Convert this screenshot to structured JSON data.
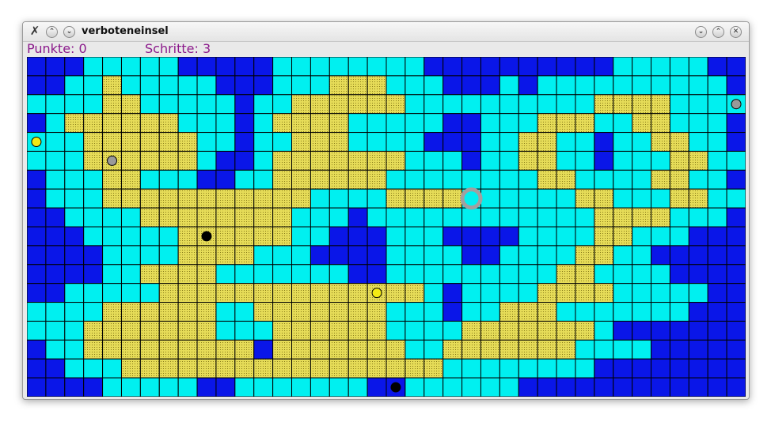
{
  "window": {
    "title": "verboteneinsel"
  },
  "status": {
    "punkte_label": "Punkte:",
    "punkte_value": "0",
    "schritte_label": "Schritte:",
    "schritte_value": "3"
  },
  "colors": {
    "deep_water": "#0a16e8",
    "shallow_water": "#00f0f0",
    "land": "#e6dc58",
    "grid": "#000000",
    "text_accent": "#8b1a8b"
  },
  "board": {
    "rows": 18,
    "cols": 38,
    "legend": {
      "D": "deep-water",
      "W": "shallow-water",
      "L": "land"
    },
    "map": [
      "DDDWWWWWDDDDDWWWWWWWWDDDDDDDDDDWWWWWDD",
      "DDWWLWWWWWDDDWWWLLLWWWDDDWDWWWWWWWWWWD",
      "WWWWLLWWWWWDWWLLLLLLWWWWWWWWWWLLLLWWWW",
      "DWLLLLLLWWWDWLLLLWWWWWDDWWWLLLWWLLWWWD",
      "WWWLLLLLLWWDWWLLLWWWWDDDWWLLWWDWWLLWWD",
      "WWWLLLLLLWDDWLLLLLLLWWWDWWLLWWDWWWLLWW",
      "DWWWLLWWWDDWWLLLLLLWWWWWWWWLLWWWWLLWWD",
      "DWWWLLLLLLLLLLLWWWWLLLLWWWWWWLLWWWLLWWD",
      "DDWWWWLLLLLLLLWWWDWWWWWWWWWWWWLLLLWWWD",
      "DDDWWWWWLLLLLLWWDDDWWWDDDDWWWWLLWWWDDD",
      "DDDDWWWWLLLLWWWDDDDWWWWDDWWWWLLWWDDDDD",
      "DDDDWWLLLLWWWWWWWDDWWWWWWWWWLLWWWWDDDD",
      "DDWWWWWLLLLLLLLLLLLLLWDWWWWLLLLWWWWWDD",
      "WWWWLLLLLLWWLLLLLLLWWWDWWLLLWWWWWWWDDD",
      "WWWLLLLLLLWWWLLLLLLWWWWLLLLLLLWDDDDDDD",
      "DWWLLLLLLLLLDLLLLLLLWWLLLLLLLWWWWDDDDD",
      "DDWWWLLLLLLLLLLLLLLLLLWWWWWWWWDDDDDDDD",
      "DDDDWWWWWDDWWWWWWWDDWWWWWWDDDDDDDDDDDD"
    ],
    "tokens": [
      {
        "name": "yellow-token",
        "row": 4,
        "col": 0,
        "color": "#f3ea14"
      },
      {
        "name": "yellow-token",
        "row": 12,
        "col": 18,
        "color": "#f3ea14"
      },
      {
        "name": "grey-token",
        "row": 5,
        "col": 4,
        "color": "#9a9a9a"
      },
      {
        "name": "grey-token",
        "row": 2,
        "col": 37,
        "color": "#9a9a9a"
      },
      {
        "name": "black-token",
        "row": 9,
        "col": 9,
        "color": "#000000"
      },
      {
        "name": "black-token",
        "row": 17,
        "col": 19,
        "color": "#000000"
      }
    ],
    "player": {
      "row": 7,
      "col": 23,
      "color": "#a0a0a0"
    }
  }
}
